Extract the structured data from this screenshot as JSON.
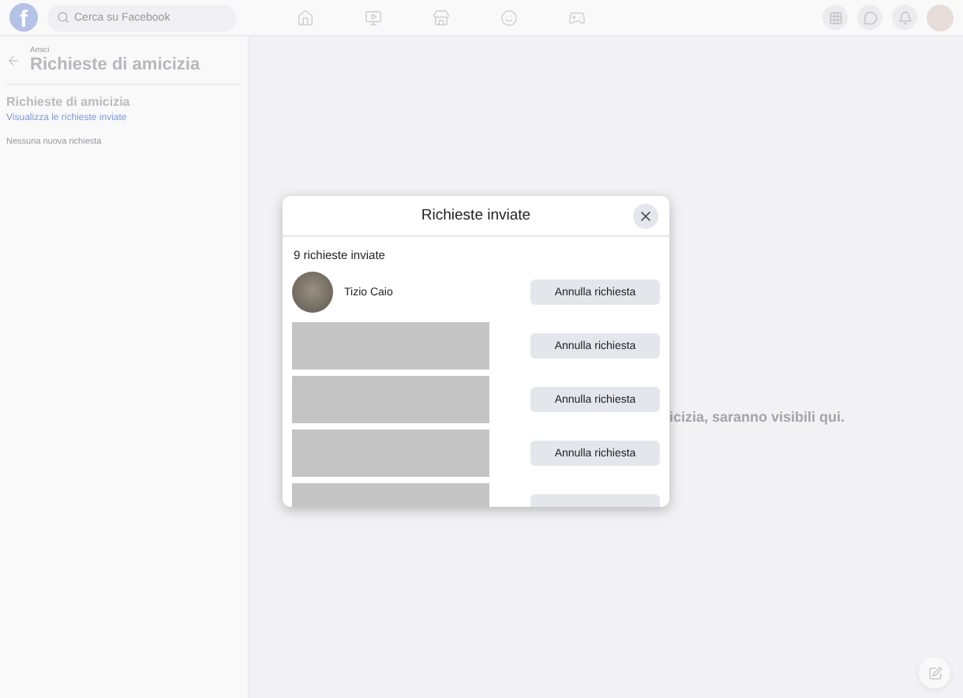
{
  "topbar": {
    "logo": "f",
    "search": {
      "placeholder": "Cerca su Facebook"
    }
  },
  "sidebar": {
    "breadcrumb": "Amici",
    "title": "Richieste di amicizia",
    "section": "Richieste di amicizia",
    "link": "Visualizza le richieste inviate",
    "empty": "Nessuna nuova richiesta"
  },
  "main": {
    "message": "icizia, saranno visibili qui."
  },
  "dialog": {
    "title": "Richieste inviate",
    "count": "9 richieste inviate",
    "rows": [
      {
        "kind": "person",
        "name": "Tizio Caio",
        "button": "Annulla richiesta"
      },
      {
        "kind": "hidden",
        "button": "Annulla richiesta"
      },
      {
        "kind": "hidden",
        "button": "Annulla richiesta"
      },
      {
        "kind": "hidden",
        "button": "Annulla richiesta"
      },
      {
        "kind": "hidden"
      }
    ]
  }
}
